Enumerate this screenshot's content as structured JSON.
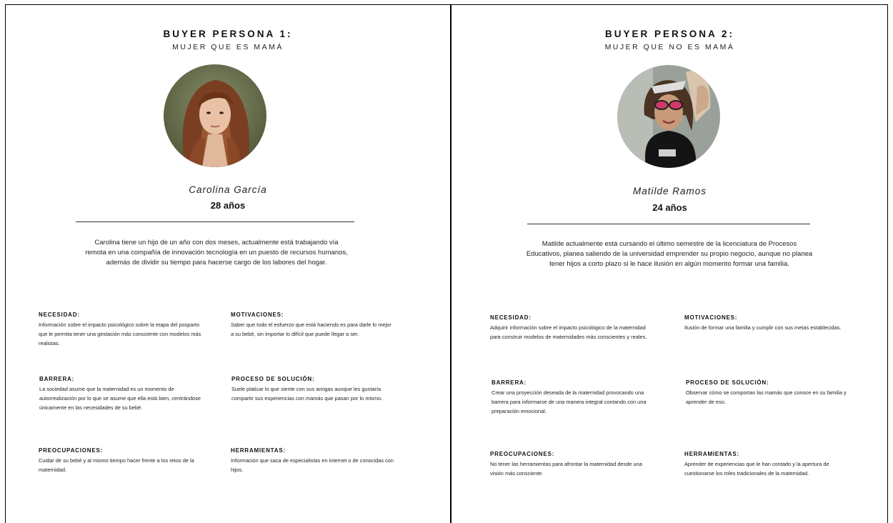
{
  "persona1": {
    "title": "BUYER PERSONA 1:",
    "subtitle": "MUJER QUE ES MAMÁ",
    "name": "Carolina García",
    "age": "28 años",
    "bio": "Carolina tiene un hijo de un año con dos meses, actualmente está trabajando vía remota en una compañía de innovación tecnología en un puesto de recursos humanos, además de dividir su tiempo para  hacerse cargo de los labores del hogar.",
    "necesidad": {
      "label": "NECESIDAD:",
      "text": "Información sobre el impacto psicológico sobre la etapa del posparto que le permita tener una gestación  más consciente con modelos más realistas."
    },
    "motivaciones": {
      "label": "MOTIVACIONES:",
      "text": "Saber que todo el esfuerzo que está haciendo es para darle lo mejor a su bebé, sin importar lo difícil que puede llegar a ser."
    },
    "barrera": {
      "label": "BARRERA:",
      "text": "La sociedad asume que la maternidad es un momento de autorrealización por lo que se asume que ella está bien, centrándose únicamente en las necesidades de su bebé."
    },
    "proceso": {
      "label": "PROCESO DE SOLUCIÓN:",
      "text": "Suele platicar lo que siente con sus amigas aunque les gustaría compartir sus experiencias con mamás que pasan por lo mismo."
    },
    "preocupaciones": {
      "label": "PREOCUPACIONES:",
      "text": "Cuidar de su bebé y al mismo tiempo hacer frente a los retos de la maternidad."
    },
    "herramientas": {
      "label": "HERRAMIENTAS:",
      "text": "Información que saca de especialistas en internet o de conocidas con hijos."
    }
  },
  "persona2": {
    "title": "BUYER PERSONA 2:",
    "subtitle": "MUJER QUE NO ES MAMÁ",
    "name": "Matilde Ramos",
    "age": "24 años",
    "bio": "Matilde actualmente está cursando el último semestre de la licenciatura de Procesos Educativos, planea saliendo de la universidad emprender su propio negocio, aunque no planea tener hijos a corto plazo si le hace ilusión en algún momento formar una familia.",
    "necesidad": {
      "label": "NECESIDAD:",
      "text": "Adquirir información sobre el impacto psicológico de la maternidad para construir modelos de maternidades más conscientes y reales."
    },
    "motivaciones": {
      "label": "MOTIVACIONES:",
      "text": "Ilusión de formar una familia y cumplir con sus metas establecidas."
    },
    "barrera": {
      "label": "BARRERA:",
      "text": "Crear una proyección deseada de la maternidad provocando una barrera para informarse de una manera integral contando con una preparación emocional."
    },
    "proceso": {
      "label": "PROCESO DE SOLUCIÓN:",
      "text": "Observar cómo se comportan las mamás que conoce en su familia y aprender de eso."
    },
    "preocupaciones": {
      "label": "PREOCUPACIONES:",
      "text": "No tener las herramientas para afrontar la maternidad desde una visión más consciente."
    },
    "herramientas": {
      "label": "HERRAMIENTAS:",
      "text": "Aprender de experiencias que le han contado y la apertura de cuestionarse los roles tradicionales de la maternidad."
    }
  }
}
